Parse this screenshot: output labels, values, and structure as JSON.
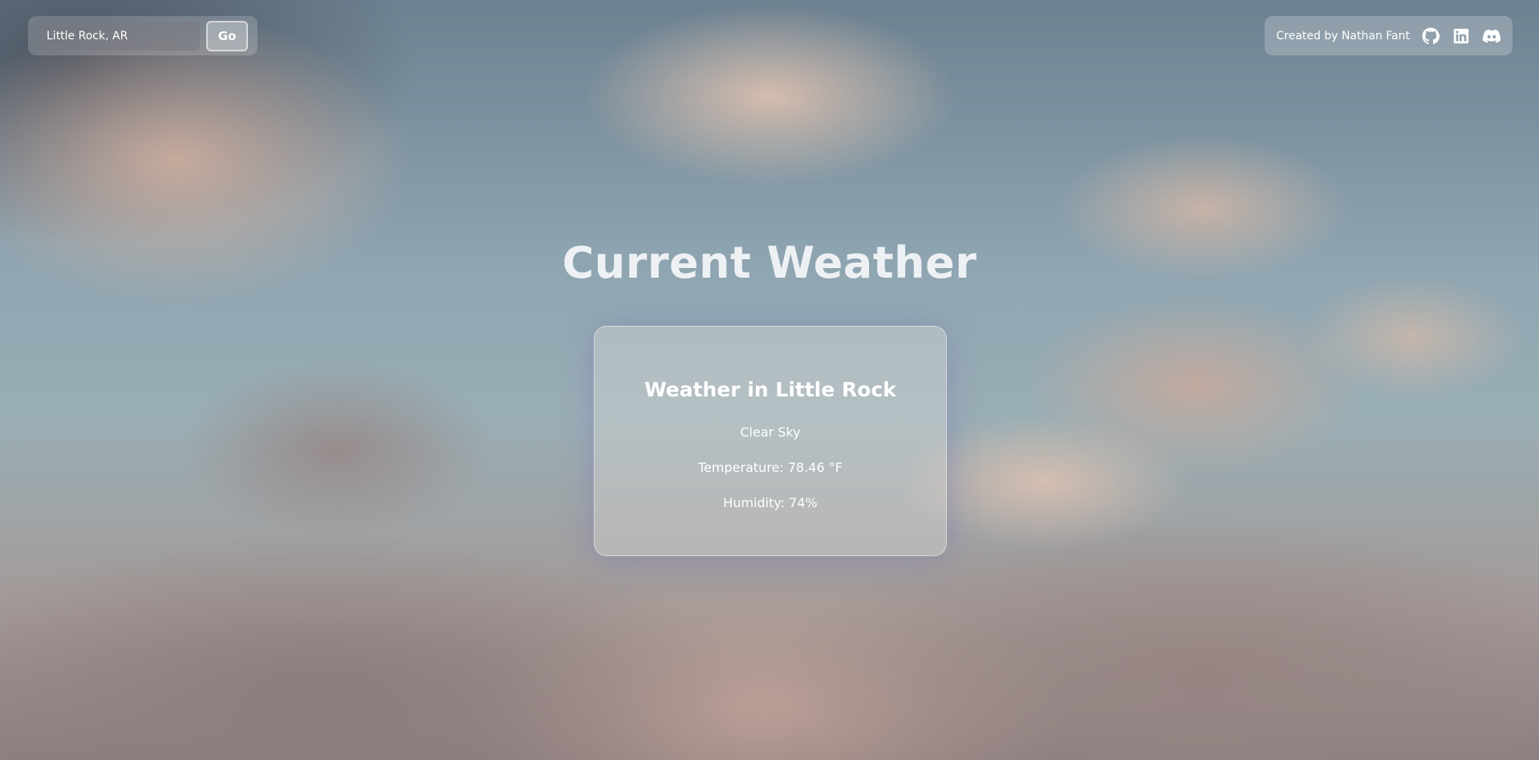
{
  "search": {
    "value": "Little Rock, AR",
    "button_label": "Go"
  },
  "credit": {
    "text": "Created by Nathan Fant",
    "icons": [
      "github-icon",
      "linkedin-icon",
      "discord-icon"
    ]
  },
  "main": {
    "title": "Current Weather"
  },
  "weather": {
    "title": "Weather in Little Rock",
    "description": "Clear Sky",
    "temperature": "Temperature: 78.46 °F",
    "humidity": "Humidity: 74%"
  }
}
